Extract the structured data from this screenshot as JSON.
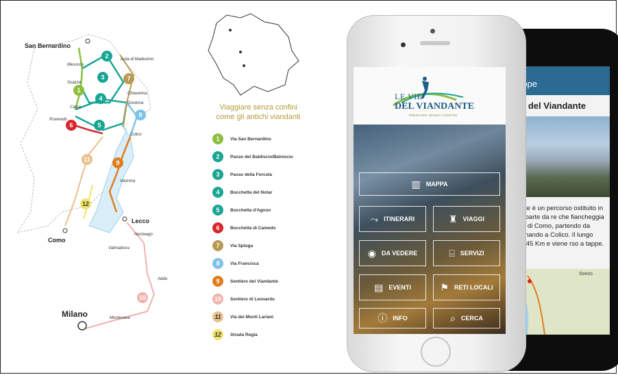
{
  "map": {
    "cities": [
      "San Bernardino",
      "Como",
      "Lecco",
      "Milano"
    ],
    "towns": [
      "Isola di Madesimo",
      "Mesocco",
      "Soazza",
      "Chiavenna",
      "Gordona",
      "Cama",
      "Roveredo",
      "Colico",
      "Varenna",
      "Herzwago",
      "Valmadrera",
      "Adda",
      "Montesana"
    ],
    "route_numbers": [
      "1",
      "2",
      "3",
      "4",
      "5",
      "6",
      "7",
      "8",
      "9",
      "10",
      "11",
      "12"
    ]
  },
  "legend": {
    "title_line1": "Viaggiare senza confini",
    "title_line2": "come gli antichi viandanti",
    "items": [
      {
        "num": "1",
        "label": "Via San Bernardino",
        "color": "#8cbf3f"
      },
      {
        "num": "2",
        "label": "Passo del Baldiscio/Balniscio",
        "color": "#19a594"
      },
      {
        "num": "3",
        "label": "Passo della Forcola",
        "color": "#19a594"
      },
      {
        "num": "4",
        "label": "Bocchetta del Notar",
        "color": "#19a594"
      },
      {
        "num": "5",
        "label": "Bocchetta d'Agnon",
        "color": "#19a594"
      },
      {
        "num": "6",
        "label": "Bocchetta di Camedo",
        "color": "#d9262c"
      },
      {
        "num": "7",
        "label": "Via Spluga",
        "color": "#b99a55"
      },
      {
        "num": "8",
        "label": "Via Francisca",
        "color": "#7ec3e6"
      },
      {
        "num": "9",
        "label": "Sentiero del Viandante",
        "color": "#e07d1f"
      },
      {
        "num": "10",
        "label": "Sentiero di Leonardo",
        "color": "#efb3ae"
      },
      {
        "num": "11",
        "label": "Via dei Monti Lariani",
        "color": "#e9c18a"
      },
      {
        "num": "12",
        "label": "Strada Regia",
        "color": "#f2e36a"
      }
    ]
  },
  "app": {
    "logo_line1": "LE VIE",
    "logo_line2": "DEL VIANDANTE",
    "logo_tag": "TREKKING SENZA CONFINI",
    "menu": {
      "map": "MAPPA",
      "itineraries": "ITINERARI",
      "trips": "VIAGGI",
      "to_see": "DA VEDERE",
      "services": "SERVIZI",
      "events": "EVENTI",
      "local_networks": "RETI LOCALI",
      "info": "INFO",
      "search": "CERCA"
    },
    "back_screen": {
      "header": "appe",
      "title": "ero del Viandante",
      "text": "ndante è un percorso ostituito in gran parte da re che fiancheggia il lato di Como, partendo da terminando a Colico. Il lungo circa 45 Km e viene rso a tappe.",
      "map_label": "Sorico"
    }
  }
}
